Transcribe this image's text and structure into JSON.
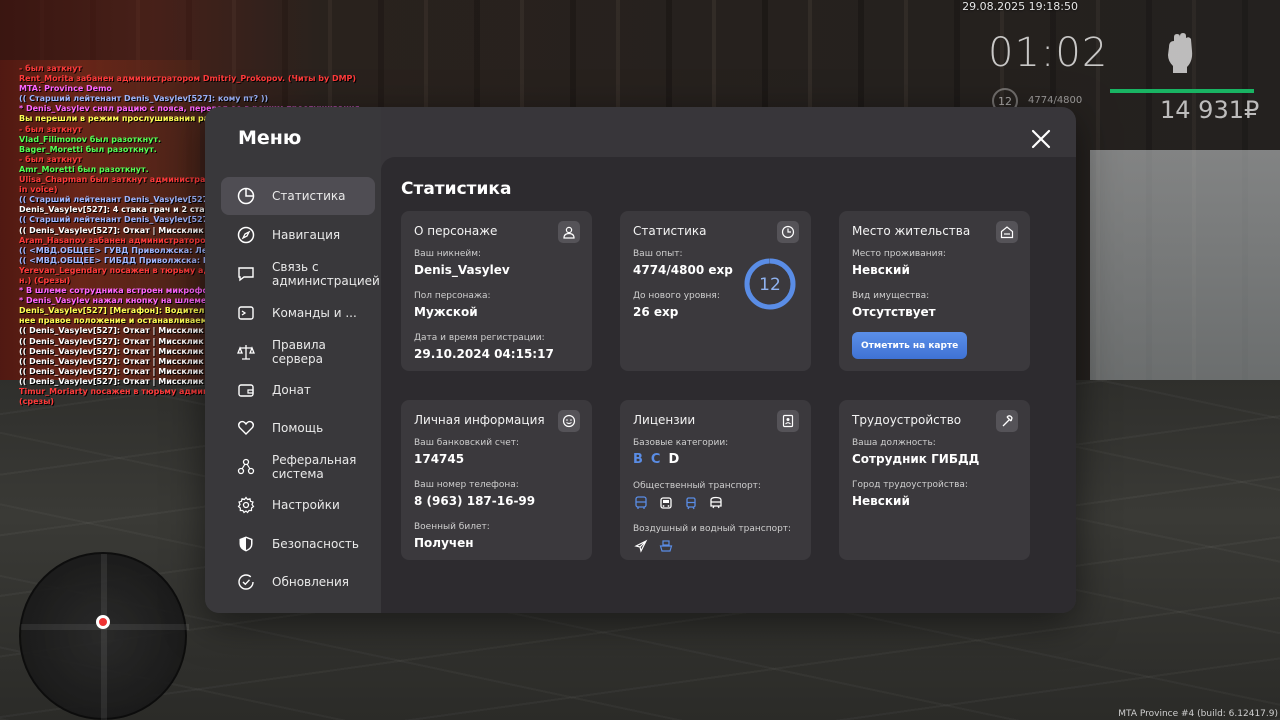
{
  "hud": {
    "datetime": "29.08.2025 19:18:50",
    "clock": "01:02",
    "level": "12",
    "exp": "4774/4800",
    "money": "14 931₽",
    "build": "MTA Province #4 (build: 6.12417.9)"
  },
  "chat": [
    {
      "text": "- был заткнут",
      "color": "#ff3b3b"
    },
    {
      "text": "Rent_Morita забанен администратором Dmitriy_Prokopov. (Читы by DMP)",
      "color": "#ff3b3b"
    },
    {
      "text": "MTA: Province Demo",
      "color": "#ff66ff"
    },
    {
      "text": "(( Старший лейтенант Denis_Vasylev[527]: кому пт? ))",
      "color": "#9fb6ff"
    },
    {
      "text": "* Denis_Vasylev снял рацию с пояса, перевел ее в режим прослушивания",
      "color": "#ff66ff"
    },
    {
      "text": "Вы перешли в режим прослушивания рации.",
      "color": "#ffff55"
    },
    {
      "text": "- был заткнут",
      "color": "#ff3b3b"
    },
    {
      "text": "Vlad_Filimonov был разоткнут.",
      "color": "#55ff55"
    },
    {
      "text": "Bager_Moretti был разоткнут.",
      "color": "#55ff55"
    },
    {
      "text": "- был заткнут",
      "color": "#ff3b3b"
    },
    {
      "text": "Amr_Moretti был разоткнут.",
      "color": "#55ff55"
    },
    {
      "text": "Ulisa_Chapman был заткнут администратором Xavier_Manchine (2 час.) (Music",
      "color": "#ff3b3b"
    },
    {
      "text": "in voice)",
      "color": "#ff3b3b"
    },
    {
      "text": "(( Старший лейтенант Denis_Vasylev[527]: кому пт? ))",
      "color": "#9fb6ff"
    },
    {
      "text": "Denis_Vasylev[527]: 4 стака грач и 2 стака на 74ку",
      "color": "#ffffff"
    },
    {
      "text": "(( Старший лейтенант Denis_Vasylev[527]: 4 стака грач и 2 стака на 74ку ))",
      "color": "#9fb6ff"
    },
    {
      "text": "(( Denis_Vasylev[527]: Откат | Миссклик | Показалось ))",
      "color": "#ffffff"
    },
    {
      "text": "Aram_Hasanov забанен администратором Xavier_Manchine (3 дн.) (DH by KM)",
      "color": "#ff3b3b"
    },
    {
      "text": "(( <МВД.ОБЩЕЕ> ГУВД Приволжска: Лейтенант Ilya_Falcons[132]: гибдд есть? ))",
      "color": "#9fb6ff"
    },
    {
      "text": "(( <МВД.ОБЩЕЕ> ГИБДД Приволжска: Прапорщик Mansur_McCall[487]: нет ))",
      "color": "#9fb6ff"
    },
    {
      "text": "Yerevan_Legendary посажен в тюрьму администратором Xavier_Manchine (30 ми",
      "color": "#ff3b3b"
    },
    {
      "text": "н.) (Срезы)",
      "color": "#ff3b3b"
    },
    {
      "text": "* В шлеме сотрудника встроен микрофон от СГУ. (Denis_Vasylev)",
      "color": "#ff66ff"
    },
    {
      "text": "* Denis_Vasylev нажал кнопку на шлеме и крикнул во встроенный микрофон",
      "color": "#ff66ff"
    },
    {
      "text": "Denis_Vasylev[527] [Мегафон]: Водитель впередиидущего ТС, примите правый край",
      "color": "#ffff55"
    },
    {
      "text": "нее правое положение и останавливаемся!",
      "color": "#ffff55"
    },
    {
      "text": "(( Denis_Vasylev[527]: Откат | Миссклик | Показалось ))",
      "color": "#ffffff"
    },
    {
      "text": "(( Denis_Vasylev[527]: Откат | Миссклик | Показалось ))",
      "color": "#ffffff"
    },
    {
      "text": "(( Denis_Vasylev[527]: Откат | Миссклик | Показалось ))",
      "color": "#ffffff"
    },
    {
      "text": "(( Denis_Vasylev[527]: Откат | Миссклик | Показалось ))",
      "color": "#ffffff"
    },
    {
      "text": "(( Denis_Vasylev[527]: Откат | Миссклик | Показалось ))",
      "color": "#ffffff"
    },
    {
      "text": "(( Denis_Vasylev[527]: Откат | Миссклик | Показалось ))",
      "color": "#ffffff"
    },
    {
      "text": "Timur_Moriarty посажен в тюрьму администратором Natalie_Manchine (30 мин.)",
      "color": "#ff3b3b"
    },
    {
      "text": "(срезы)",
      "color": "#ff3b3b"
    }
  ],
  "menu": {
    "title": "Меню",
    "nav": [
      {
        "label": "Статистика",
        "icon": "pie-chart-icon"
      },
      {
        "label": "Навигация",
        "icon": "compass-icon"
      },
      {
        "label": "Связь с администрацией",
        "icon": "chat-icon"
      },
      {
        "label": "Команды и ...",
        "icon": "command-icon"
      },
      {
        "label": "Правила сервера",
        "icon": "scales-icon"
      },
      {
        "label": "Донат",
        "icon": "wallet-icon"
      },
      {
        "label": "Помощь",
        "icon": "heart-icon"
      },
      {
        "label": "Реферальная система",
        "icon": "referral-icon"
      },
      {
        "label": "Настройки",
        "icon": "gear-icon"
      },
      {
        "label": "Безопасность",
        "icon": "shield-icon"
      },
      {
        "label": "Обновления",
        "icon": "update-icon"
      }
    ]
  },
  "stats": {
    "title": "Статистика",
    "character": {
      "title": "О персонаже",
      "nick_label": "Ваш никнейм:",
      "nick": "Denis_Vasylev",
      "sex_label": "Пол персонажа:",
      "sex": "Мужской",
      "reg_label": "Дата и время регистрации:",
      "reg": "29.10.2024 04:15:17"
    },
    "statistics": {
      "title": "Статистика",
      "exp_label": "Ваш опыт:",
      "exp": "4774/4800 exp",
      "next_label": "До нового уровня:",
      "next": "26 exp",
      "level": "12",
      "progress": 0.9946
    },
    "residence": {
      "title": "Место жительства",
      "place_label": "Место проживания:",
      "place": "Невский",
      "property_label": "Вид имущества:",
      "property": "Отсутствует",
      "button": "Отметить на карте"
    },
    "personal": {
      "title": "Личная информация",
      "bank_label": "Ваш банковский счет:",
      "bank": "174745",
      "phone_label": "Ваш номер телефона:",
      "phone": "8 (963) 187-16-99",
      "military_label": "Военный билет:",
      "military": "Получен"
    },
    "licenses": {
      "title": "Лицензии",
      "base_label": "Базовые категории:",
      "base": [
        {
          "cat": "B",
          "owned": true
        },
        {
          "cat": "C",
          "owned": true
        },
        {
          "cat": "D",
          "owned": false
        }
      ],
      "public_label": "Общественный транспорт:",
      "public_icons": [
        "bus-icon",
        "trolleybus-icon",
        "tram-icon",
        "metro-icon"
      ],
      "air_label": "Воздушный и водный транспорт:",
      "air_icons": [
        "airplane-icon",
        "boat-icon"
      ]
    },
    "job": {
      "title": "Трудоустройство",
      "position_label": "Ваша должность:",
      "position": "Сотрудник ГИБДД",
      "city_label": "Город трудоустройства:",
      "city": "Невский"
    }
  }
}
